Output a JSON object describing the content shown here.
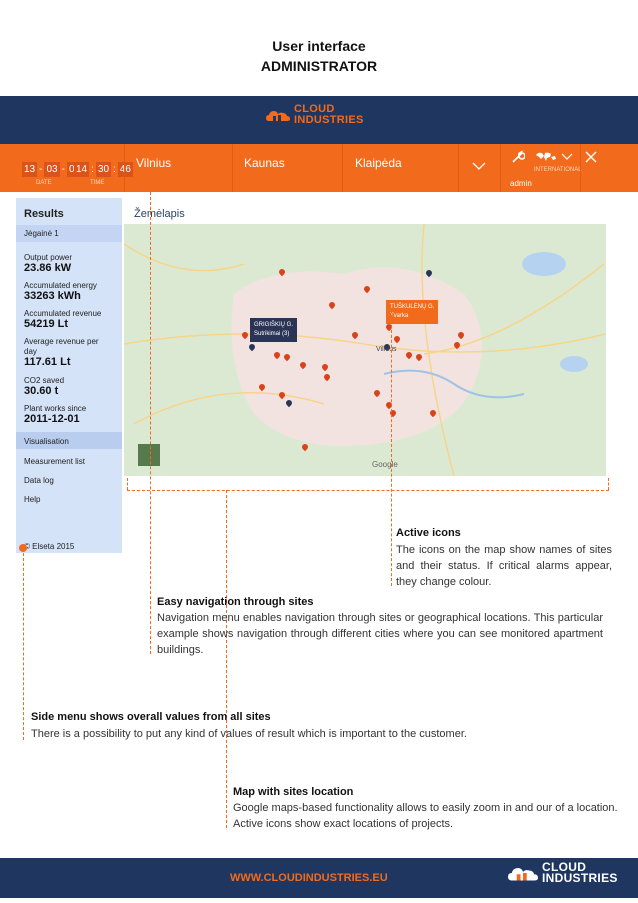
{
  "page": {
    "title_line1": "User interface",
    "title_line2": "ADMINISTRATOR"
  },
  "brand": {
    "line1": "CLOUD",
    "line2": "INDUSTRIES",
    "url": "WWW.CLOUDINDUSTRIES.EU",
    "colors": {
      "navy": "#1f3760",
      "orange": "#f26a1b",
      "sidebar": "#d5e3f8"
    }
  },
  "clock": {
    "date": [
      "13",
      "03",
      "05"
    ],
    "time": [
      "14",
      "30",
      "46"
    ],
    "date_label": "DATE",
    "time_label": "TIME"
  },
  "nav": {
    "tabs": [
      "Vilnius",
      "Kaunas",
      "Klaipėda"
    ],
    "dropdown_icon": "chevron-down-icon",
    "settings_icon": "wrench-icon",
    "region_label": "INTERNATIONAL",
    "user": "admin",
    "close_icon": "close-icon"
  },
  "sidebar": {
    "heading": "Results",
    "site": "Jėgainė 1",
    "metrics": [
      {
        "label": "Output power",
        "value": "23.86 kW"
      },
      {
        "label": "Accumulated energy",
        "value": "33263 kWh"
      },
      {
        "label": "Accumulated revenue",
        "value": "54219 Lt"
      },
      {
        "label": "Average revenue per day",
        "value": "117.61 Lt"
      },
      {
        "label": "CO2 saved",
        "value": "30.60 t"
      },
      {
        "label": "Plant works since",
        "value": "2011-12-01"
      }
    ],
    "menu": [
      "Visualisation",
      "Measurement list",
      "Data log",
      "Help"
    ],
    "copyright": "© Elseta 2015"
  },
  "map": {
    "heading": "Žemėlapis",
    "popup1": {
      "title": "GRIGIŠKIŲ G.",
      "status": "Sutrikimai (3)"
    },
    "popup2": {
      "title": "TUŠKULĖNŲ G.",
      "status": "Tvarka"
    },
    "provider": "Google",
    "city_label": "Vilnius"
  },
  "annotations": {
    "active_icons": {
      "title": "Active icons",
      "body": "The icons on the map show names of sites and their status. If critical alarms appear, they change colour."
    },
    "easy_nav": {
      "title": "Easy navigation through sites",
      "body": "Navigation menu enables navigation through sites or geographical locations. This particular example shows navigation through different cities where you can see monitored apartment buildings."
    },
    "side_menu": {
      "title": "Side menu shows overall values from all sites",
      "body": "There is a possibility to put any kind of values of result which is important to the customer."
    },
    "map_sites": {
      "title": "Map with sites location",
      "body": "Google maps-based functionality allows to easily zoom in and our of a location. Active icons show exact locations of projects."
    }
  }
}
